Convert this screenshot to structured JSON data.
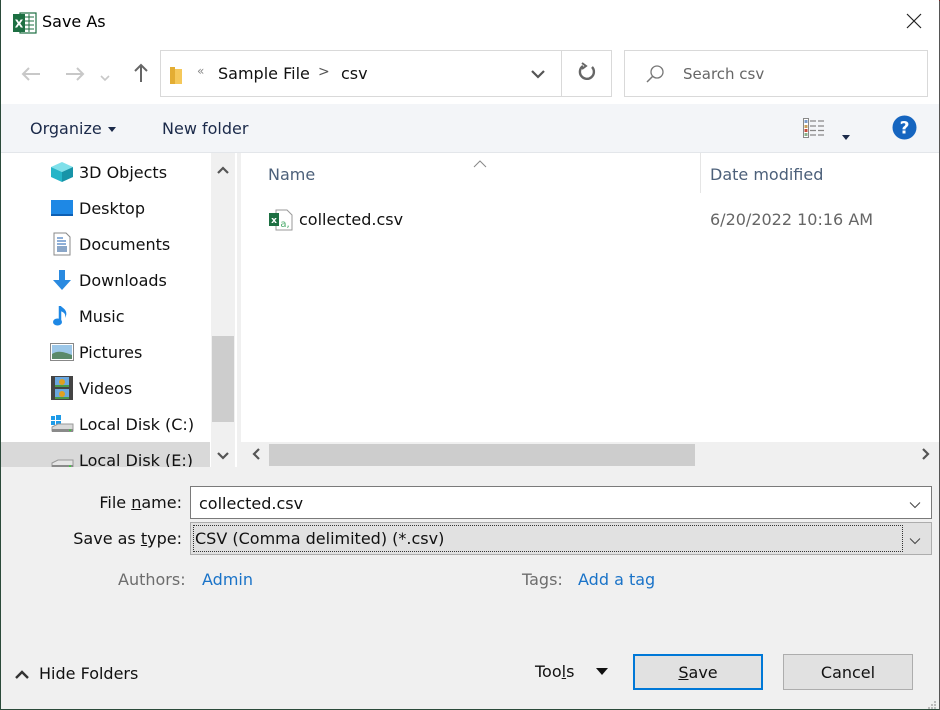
{
  "window": {
    "title": "Save As",
    "app_icon": "excel-icon"
  },
  "navigation": {
    "back_icon": "arrow-left-icon",
    "forward_icon": "arrow-right-icon",
    "recent_icon": "chevron-down-icon",
    "up_icon": "arrow-up-icon",
    "address": {
      "overflow_glyph": "«",
      "breadcrumbs": [
        "Sample File",
        "csv"
      ],
      "separator": ">"
    },
    "refresh_icon": "refresh-icon",
    "search": {
      "placeholder": "Search csv",
      "value": ""
    }
  },
  "command_bar": {
    "organize_label": "Organize",
    "new_folder_label": "New folder",
    "view_icon": "details-view-icon",
    "help_icon": "help-icon"
  },
  "nav_pane": {
    "items": [
      {
        "label": "3D Objects",
        "icon": "3d-objects-icon"
      },
      {
        "label": "Desktop",
        "icon": "desktop-icon"
      },
      {
        "label": "Documents",
        "icon": "documents-icon"
      },
      {
        "label": "Downloads",
        "icon": "downloads-icon"
      },
      {
        "label": "Music",
        "icon": "music-icon"
      },
      {
        "label": "Pictures",
        "icon": "pictures-icon"
      },
      {
        "label": "Videos",
        "icon": "videos-icon"
      },
      {
        "label": "Local Disk (C:)",
        "icon": "windows-drive-icon"
      },
      {
        "label": "Local Disk (E:)",
        "icon": "drive-icon",
        "selected": true
      }
    ]
  },
  "file_list": {
    "columns": [
      "Name",
      "Date modified"
    ],
    "sorted_by": "Name",
    "rows": [
      {
        "name": "collected.csv",
        "date_modified": "6/20/2022 10:16 AM",
        "icon": "excel-csv-file-icon"
      }
    ]
  },
  "form": {
    "file_name_label_pre": "File ",
    "file_name_label_accel": "n",
    "file_name_label_post": "ame:",
    "file_name_value": "collected.csv",
    "save_type_label_pre": "Save as ",
    "save_type_label_accel": "t",
    "save_type_label_post": "ype:",
    "save_type_value": "CSV (Comma delimited) (*.csv)",
    "authors_label": "Authors:",
    "authors_value": "Admin",
    "tags_label": "Tags:",
    "tags_value": "Add a tag"
  },
  "footer": {
    "hide_folders_label": "Hide Folders",
    "tools_label_pre": "Too",
    "tools_label_accel": "l",
    "tools_label_post": "s",
    "save_accel": "S",
    "save_rest": "ave",
    "cancel_label": "Cancel"
  },
  "colors": {
    "accent_blue": "#0078d7",
    "link_blue": "#1a73c8",
    "excel_green": "#1d6f42"
  }
}
